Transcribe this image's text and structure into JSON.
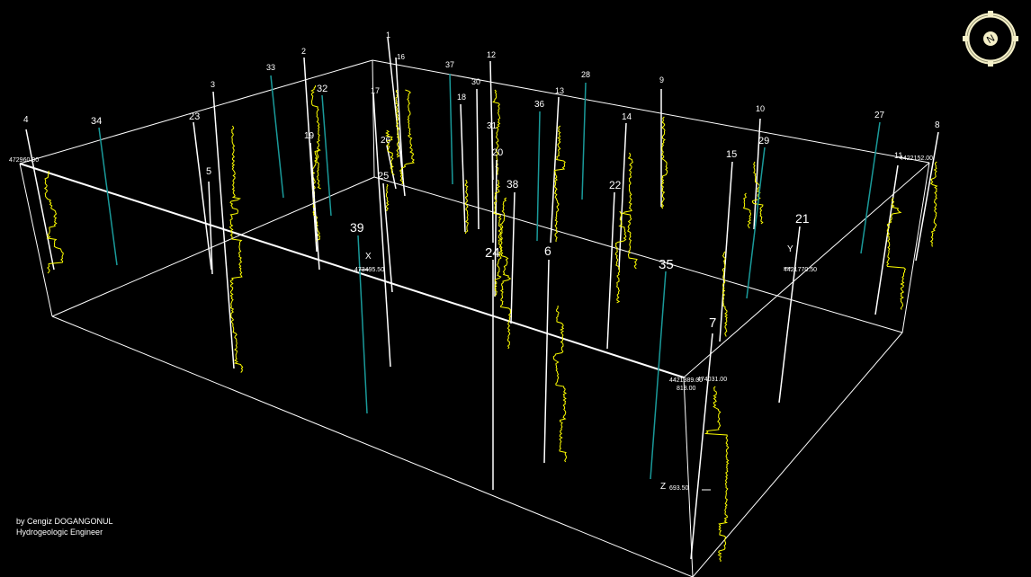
{
  "scene": {
    "colors": {
      "background": "#000000",
      "box": "#ffffff",
      "log_trace": "#ffff00",
      "teal_well": "#1a9a9a",
      "white_well": "#ffffff",
      "label": "#ffffff"
    },
    "axes": {
      "x_label": "X",
      "x_value": "473495.50",
      "y_label": "Y",
      "y_value": "4421770.50",
      "z_label": "Z",
      "z_value": "693.50",
      "corner_left_value": "472960.00",
      "corner_right_value": "4422152.00",
      "front_corner_value_1": "4421389.00",
      "front_corner_value_2": "474031.00",
      "front_corner_value_3": "813.00"
    },
    "wells": [
      {
        "id": "1"
      },
      {
        "id": "2"
      },
      {
        "id": "3"
      },
      {
        "id": "4"
      },
      {
        "id": "5"
      },
      {
        "id": "6"
      },
      {
        "id": "7"
      },
      {
        "id": "8"
      },
      {
        "id": "9"
      },
      {
        "id": "10"
      },
      {
        "id": "11"
      },
      {
        "id": "12"
      },
      {
        "id": "13"
      },
      {
        "id": "14"
      },
      {
        "id": "15"
      },
      {
        "id": "18"
      },
      {
        "id": "19"
      },
      {
        "id": "20"
      },
      {
        "id": "21"
      },
      {
        "id": "22"
      },
      {
        "id": "23"
      },
      {
        "id": "24"
      },
      {
        "id": "25"
      },
      {
        "id": "26"
      },
      {
        "id": "27"
      },
      {
        "id": "28"
      },
      {
        "id": "29"
      },
      {
        "id": "30"
      },
      {
        "id": "31"
      },
      {
        "id": "32"
      },
      {
        "id": "33"
      },
      {
        "id": "34"
      },
      {
        "id": "35"
      },
      {
        "id": "36"
      },
      {
        "id": "37"
      },
      {
        "id": "38"
      },
      {
        "id": "39"
      },
      {
        "id": "16"
      },
      {
        "id": "17"
      }
    ]
  },
  "credit": {
    "author": "by Cengiz DOGANGONUL",
    "role": "Hydrogeologic Engineer"
  },
  "compass": {
    "icon": "north-arrow-compass-icon",
    "letter": "N"
  }
}
